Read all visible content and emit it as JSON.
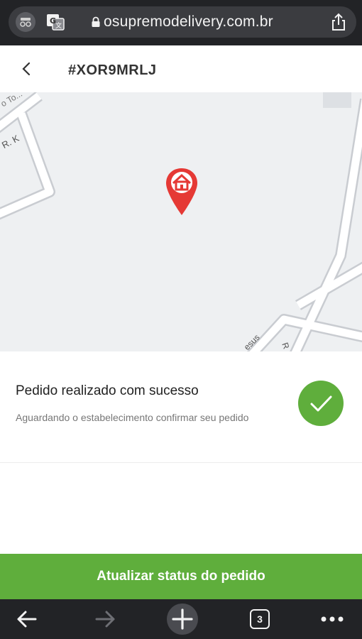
{
  "browser": {
    "url": "osupremodelivery.com.br",
    "tab_count": "3"
  },
  "header": {
    "order_code": "#XOR9MRLJ"
  },
  "map": {
    "street_labels": [
      "o To...",
      "R. K",
      "esus",
      "R"
    ],
    "marker_icon": "home-pin-icon",
    "marker_color": "#e53935"
  },
  "status": {
    "title": "Pedido realizado com sucesso",
    "description": "Aguardando o estabelecimento confirmar seu pedido",
    "icon": "check-icon",
    "color": "#5fae3c"
  },
  "actions": {
    "update_label": "Atualizar status do pedido"
  }
}
